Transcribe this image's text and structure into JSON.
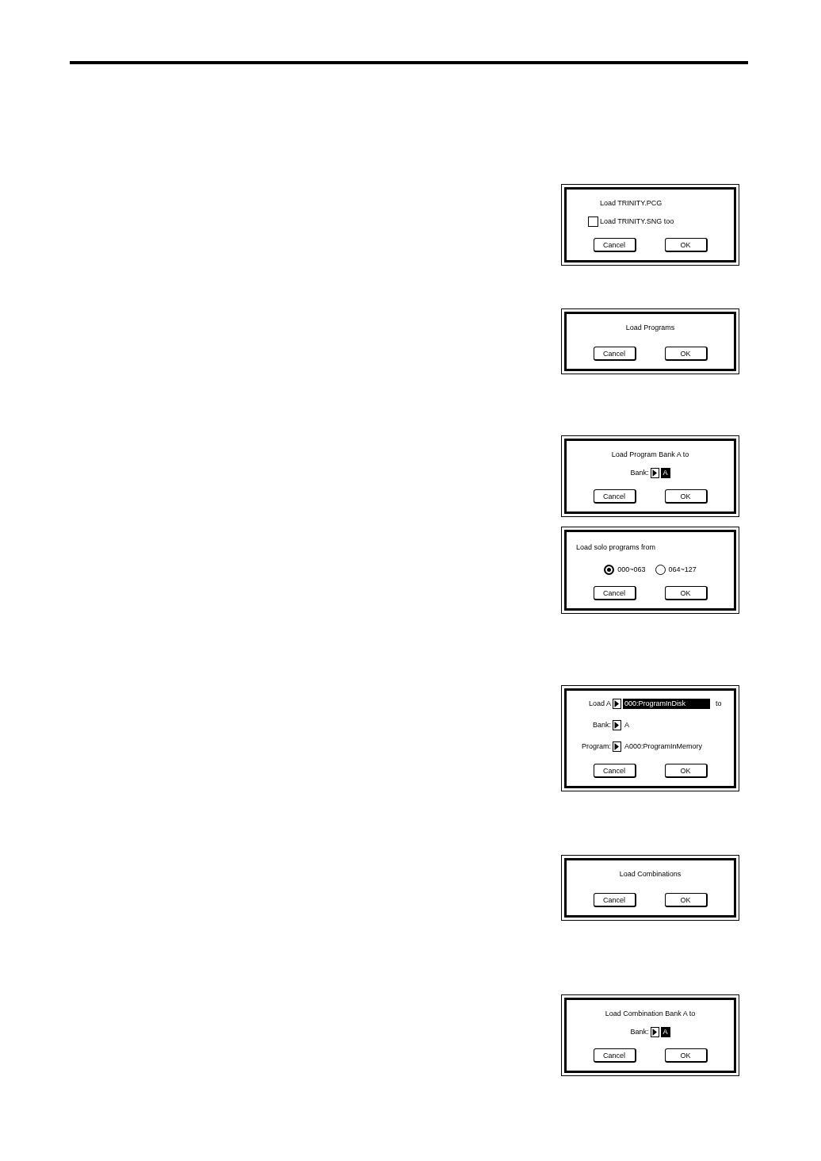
{
  "dialogs": [
    {
      "kind": "checkbox",
      "title": "Load TRINITY.PCG",
      "checkbox": {
        "label": "Load TRINITY.SNG too",
        "checked": false
      },
      "buttons": [
        "Cancel",
        "OK"
      ]
    },
    {
      "kind": "message",
      "title": "Load Programs",
      "buttons": [
        "Cancel",
        "OK"
      ]
    },
    {
      "kind": "bank",
      "title": "Load Program Bank A to",
      "fields": [
        {
          "label": "Bank:",
          "value": "A",
          "selected": true
        }
      ],
      "buttons": [
        "Cancel",
        "OK"
      ]
    },
    {
      "kind": "radio",
      "title": "Load solo programs from",
      "options": [
        {
          "label": "000~063",
          "selected": true
        },
        {
          "label": "064~127",
          "selected": false
        }
      ],
      "buttons": [
        "Cancel",
        "OK"
      ]
    },
    {
      "kind": "form",
      "fields": [
        {
          "label": "Load A",
          "value": "000:ProgramInDisk",
          "suffix": "to",
          "selected": true
        },
        {
          "label": "Bank:",
          "value": "A",
          "selected": false
        },
        {
          "label": "Program:",
          "value": "A000:ProgramInMemory",
          "selected": false
        }
      ],
      "buttons": [
        "Cancel",
        "OK"
      ]
    },
    {
      "kind": "message",
      "title": "Load Combinations",
      "buttons": [
        "Cancel",
        "OK"
      ]
    },
    {
      "kind": "bank",
      "title": "Load Combination Bank A to",
      "fields": [
        {
          "label": "Bank:",
          "value": "A",
          "selected": true
        }
      ],
      "buttons": [
        "Cancel",
        "OK"
      ]
    }
  ]
}
